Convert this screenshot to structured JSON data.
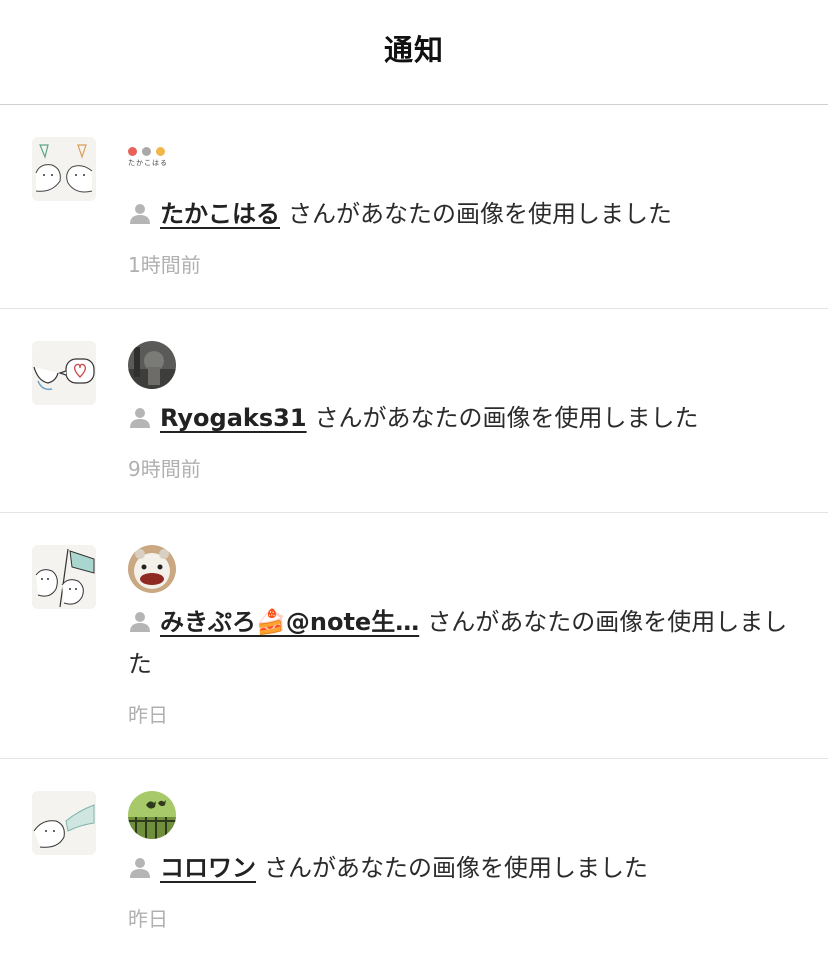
{
  "header": {
    "title": "通知"
  },
  "brand_logo": {
    "text": "たかこはる",
    "dot_colors": [
      "#e8625a",
      "#a9a9a9",
      "#f0b64a"
    ]
  },
  "notifications": [
    {
      "username": "たかこはる",
      "suffix": "さんがあなたの画像を使用しました",
      "time": "1時間前",
      "avatar_icon": "takakoharu-logo-icon",
      "thumbnail_icon": "two-characters-sketch-icon"
    },
    {
      "username": "Ryogaks31",
      "suffix": "さんがあなたの画像を使用しました",
      "time": "9時間前",
      "avatar_icon": "user-photo-avatar-icon",
      "thumbnail_icon": "bird-heart-sketch-icon"
    },
    {
      "username": "みきぷろ🍰@note生…",
      "suffix": "さんがあなたの画像を使用しました",
      "time": "昨日",
      "avatar_icon": "stuffed-toy-avatar-icon",
      "thumbnail_icon": "flag-characters-sketch-icon"
    },
    {
      "username": "コロワン",
      "suffix": "さんがあなたの画像を使用しました",
      "time": "昨日",
      "avatar_icon": "green-birds-avatar-icon",
      "thumbnail_icon": "wave-character-sketch-icon"
    }
  ]
}
